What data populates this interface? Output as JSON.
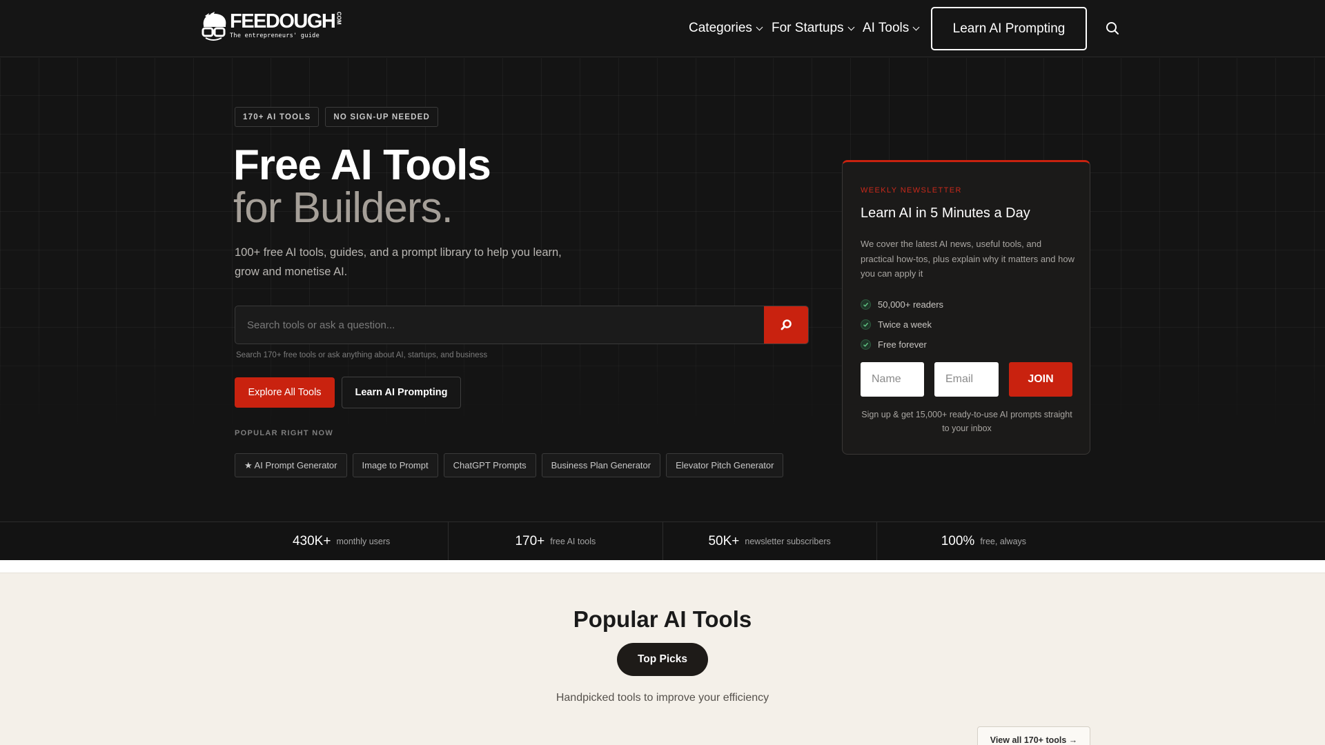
{
  "header": {
    "logo": {
      "wordmark": "FEEDOUGH",
      "suffix": "COM",
      "tagline": "The entrepreneurs' guide"
    },
    "nav": [
      {
        "label": "Categories",
        "has_dropdown": true
      },
      {
        "label": "For Startups",
        "has_dropdown": true
      },
      {
        "label": "AI Tools",
        "has_dropdown": true
      }
    ],
    "cta_label": "Learn AI Prompting",
    "search_icon": "search-icon"
  },
  "hero": {
    "badges": [
      "170+ AI TOOLS",
      "NO SIGN-UP NEEDED"
    ],
    "title_line1": "Free AI Tools",
    "title_line2": "for Builders.",
    "subtitle": "100+ free AI tools, guides, and a prompt library to help you learn, grow and monetise AI.",
    "search": {
      "placeholder": "Search tools or ask a question...",
      "value": "",
      "hint": "Search 170+ free tools or ask anything about AI, startups, and business"
    },
    "primary_button": "Explore All Tools",
    "secondary_button": "Learn AI Prompting",
    "popular_label": "POPULAR RIGHT NOW",
    "popular": [
      "★ AI Prompt Generator",
      "Image to Prompt",
      "ChatGPT Prompts",
      "Business Plan Generator",
      "Elevator Pitch Generator"
    ]
  },
  "newsletter": {
    "eyebrow": "WEEKLY NEWSLETTER",
    "title": "Learn AI in 5 Minutes a Day",
    "description": "We cover the latest AI news, useful tools, and practical how-tos, plus explain why it matters and how you can apply it",
    "perks": [
      "50,000+ readers",
      "Twice a week",
      "Free forever"
    ],
    "name_placeholder": "Name",
    "email_placeholder": "Email",
    "join_label": "JOIN",
    "footnote": "Sign up & get 15,000+ ready-to-use AI prompts straight to your inbox"
  },
  "stats": [
    {
      "value": "430K+",
      "label": "monthly users"
    },
    {
      "value": "170+",
      "label": "free AI tools"
    },
    {
      "value": "50K+",
      "label": "newsletter subscribers"
    },
    {
      "value": "100%",
      "label": "free, always"
    }
  ],
  "popular_section": {
    "title": "Popular AI Tools",
    "pill": "Top Picks",
    "subtitle": "Handpicked tools to improve your efficiency",
    "view_all": "View all 170+ tools →"
  },
  "colors": {
    "accent": "#c9220f",
    "background": "#141414",
    "section_bg": "#f4f0e9"
  }
}
